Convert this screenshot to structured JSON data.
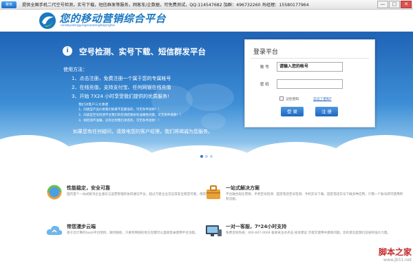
{
  "titlebar": {
    "menu_label": "菜单",
    "marquee": "提供全国手机二代空号检测，实号下载，短信群发等服务，网客车/企数据，可免费测试，QQ:114547682 加群：496732260 肖经理：15580177964",
    "min": "—",
    "max": "□",
    "close": "✕"
  },
  "header": {
    "logo_text": "您的移动营销综合平台",
    "logo_sub": "nindeyidongyingxiaozonghepingtai"
  },
  "banner": {
    "title": "空号检测、实号下载、短信群发平台",
    "usage_label": "使用方法：",
    "steps": [
      "1、点击注册，免费注册一个属于您的专属帐号",
      "2、在线充值，支持支付宝、任何网银在线充值",
      "3、开始 7X24 小时享受我们提供的优质服务!"
    ],
    "promises_title": "我们对客户三大承诺",
    "promises": [
      "1、同类型产品价格我们如果不是最低的，可无条件退款！！",
      "2、同类型空号检测平台我们的检测结果如有准确性问题，可无条件退款！！",
      "3、如检测不准确，没有达到我们承诺的，可无条件退款！！"
    ],
    "footer_text": "如果您有任何疑问，请致电您的客户经理，我们将竭诚为您服务。"
  },
  "login": {
    "title": "登录平台",
    "account_label": "账 号",
    "account_value": "请输入您的帐号",
    "password_label": "密 码",
    "password_value": "",
    "remember_label": "记住密码",
    "forgot_label": "忘记了密码?",
    "login_button": "登 录",
    "register_button": "注 册"
  },
  "features": [
    {
      "title": "性能稳定，安全可靠",
      "desc": "国内首个一站式解决企业通信与运营管理的协同通信平台，超过万家企业见证其安全稳定可靠，值得信赖。",
      "icon": "globe-arrows-icon"
    },
    {
      "title": "一站式解决方案",
      "desc": "平台融合短信营销、手机空号检测、固定电话空号检测、手机实号下载、固定电话实号下载多种应用，只需一个账号即可使用所有功能。",
      "icon": "toolbox-icon"
    },
    {
      "title": "带您漫步云端",
      "desc": "基于云计算的SaaS平台架构，随时随地，只要有网络的地方您都可以直接登录使用平台功能。",
      "icon": "cloud-sync-icon"
    },
    {
      "title": "一对一客服，7*24小时支持",
      "desc": "免费咨询热线：400-607-0004 备受关注点点击 投诉建议 可提交使用中遇到问题，您的意见是我们前进的强大力量。",
      "icon": "computer-support-icon"
    }
  ],
  "watermark": {
    "line1": "脚本之家",
    "line2": "www.jb51.net"
  },
  "colors": {
    "brand_blue": "#1a78c2",
    "banner_top": "#1f63b5",
    "button_blue": "#1f67bf"
  }
}
